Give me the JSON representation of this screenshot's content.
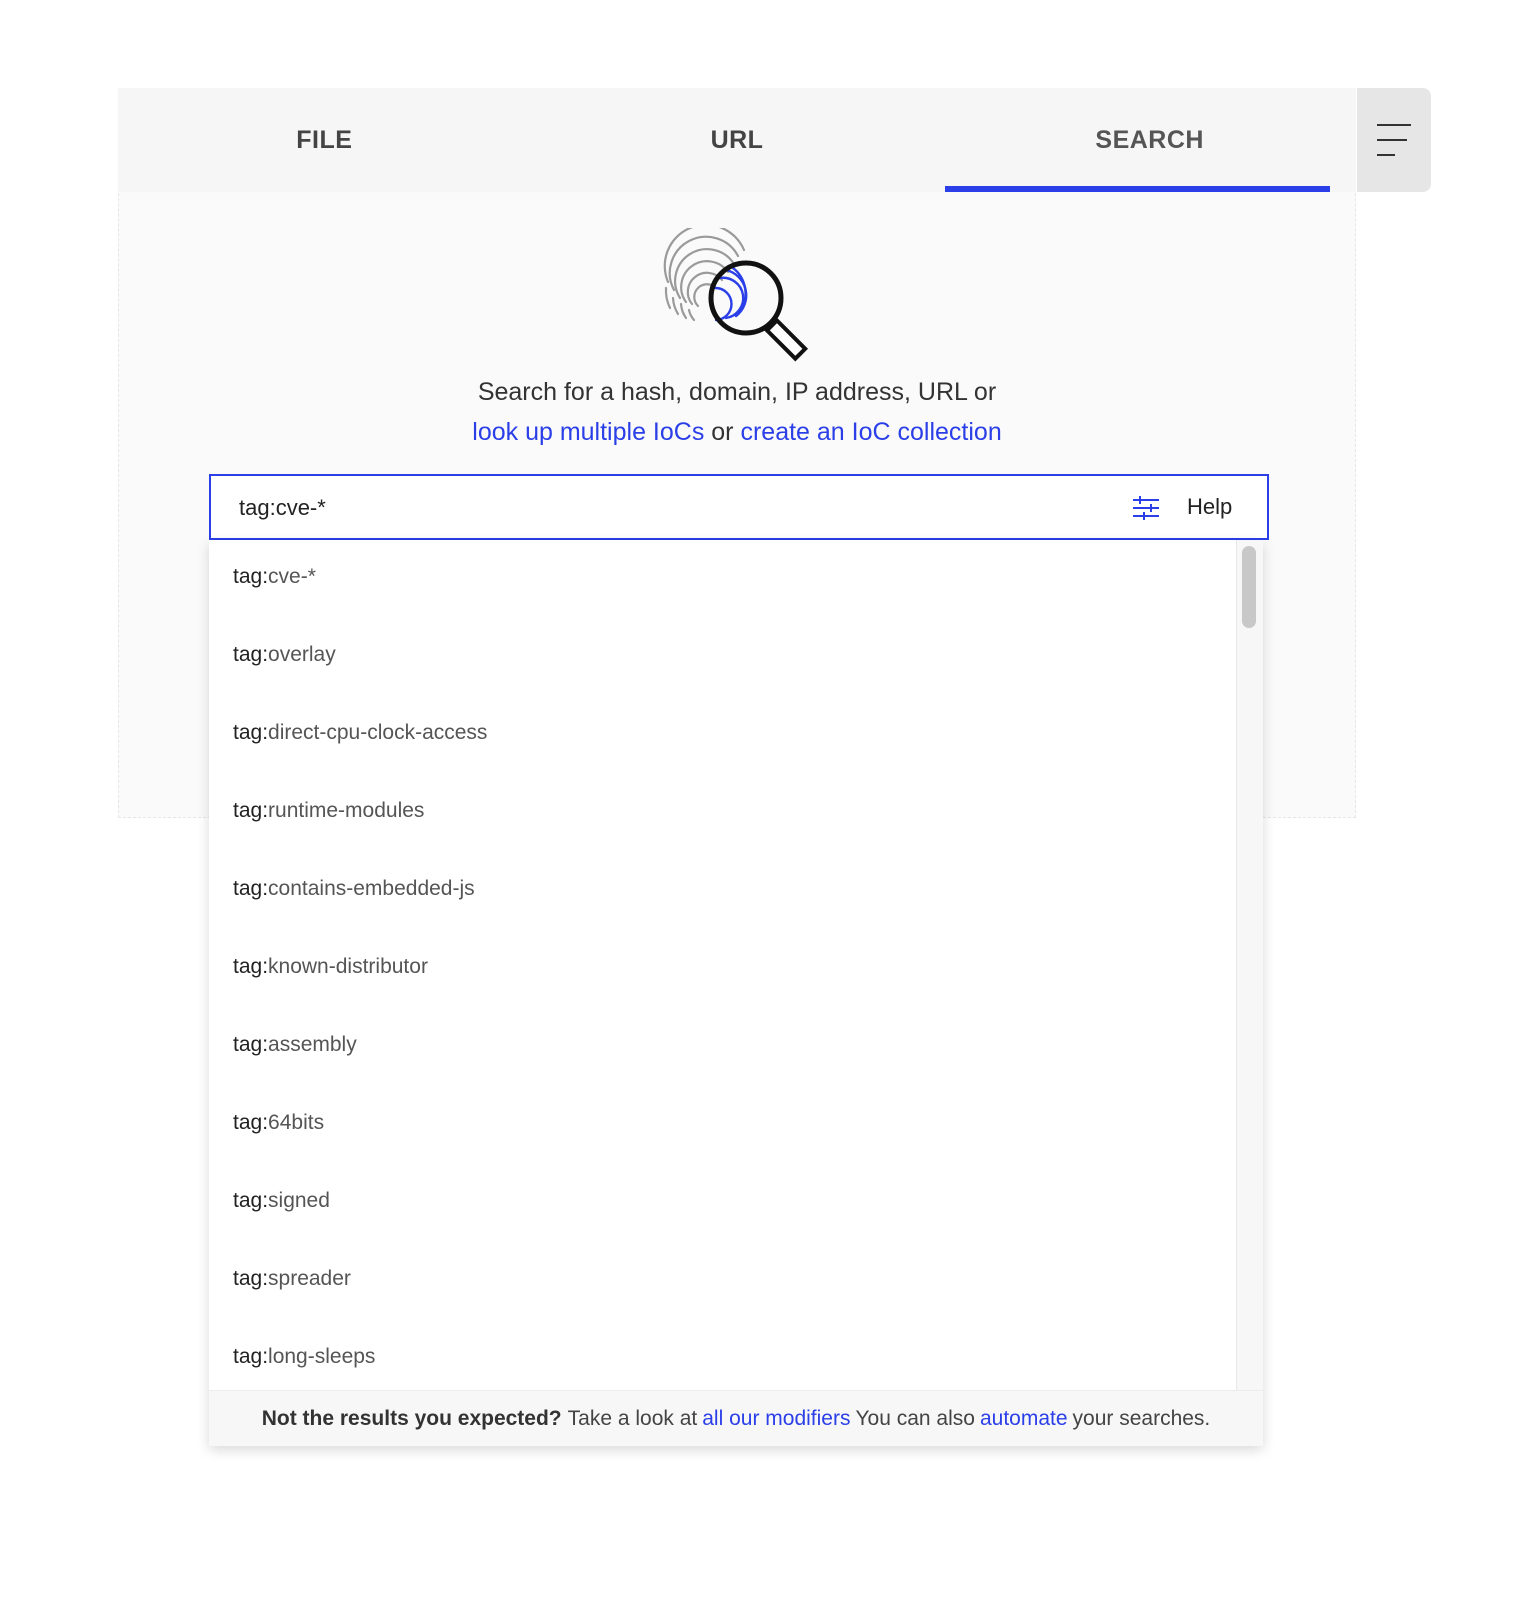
{
  "tabs": [
    {
      "label": "FILE",
      "active": false
    },
    {
      "label": "URL",
      "active": false
    },
    {
      "label": "SEARCH",
      "active": true
    }
  ],
  "menu_icon": "hamburger-menu-icon",
  "hero_icon": "fingerprint-magnifier-icon",
  "lead": {
    "text": "Search for a hash, domain, IP address, URL or",
    "link1": "look up multiple IoCs",
    "connector": "or",
    "link2": "create an IoC collection"
  },
  "search": {
    "value": "tag:cve-*",
    "filters_icon": "sliders-icon",
    "help_label": "Help"
  },
  "suggestions": [
    {
      "prefix": "tag:",
      "value": "cve-*"
    },
    {
      "prefix": "tag:",
      "value": "overlay"
    },
    {
      "prefix": "tag:",
      "value": "direct-cpu-clock-access"
    },
    {
      "prefix": "tag:",
      "value": "runtime-modules"
    },
    {
      "prefix": "tag:",
      "value": "contains-embedded-js"
    },
    {
      "prefix": "tag:",
      "value": "known-distributor"
    },
    {
      "prefix": "tag:",
      "value": "assembly"
    },
    {
      "prefix": "tag:",
      "value": "64bits"
    },
    {
      "prefix": "tag:",
      "value": "signed"
    },
    {
      "prefix": "tag:",
      "value": "spreader"
    },
    {
      "prefix": "tag:",
      "value": "long-sleeps"
    }
  ],
  "footer": {
    "bold": "Not the results you expected?",
    "text1": "Take a look at",
    "link1": "all our modifiers",
    "text2": "You can also",
    "link2": "automate",
    "text3": "your searches."
  },
  "colors": {
    "accent": "#2b3fe8",
    "tab_bar_bg": "#f6f6f6",
    "menu_bg": "#e6e6e6"
  }
}
